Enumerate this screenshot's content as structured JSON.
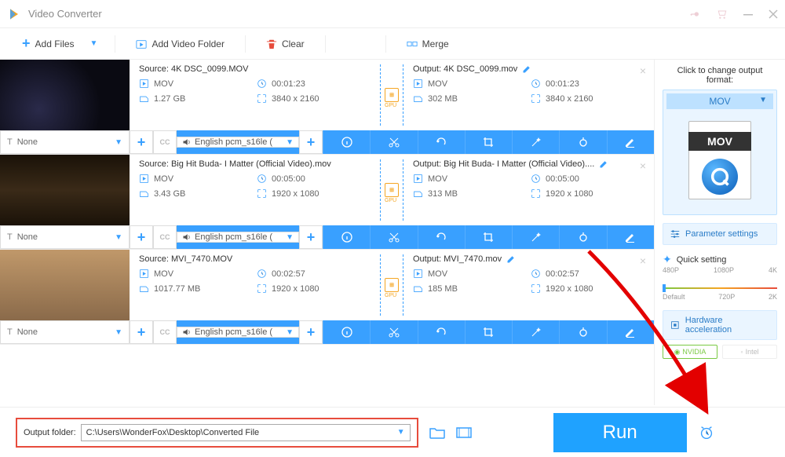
{
  "app": {
    "title": "Video Converter"
  },
  "toolbar": {
    "add_files": "Add Files",
    "add_folder": "Add Video Folder",
    "clear": "Clear",
    "merge": "Merge"
  },
  "items": [
    {
      "source_label": "Source: 4K DSC_0099.MOV",
      "output_label": "Output: 4K DSC_0099.mov",
      "src": {
        "format": "MOV",
        "duration": "00:01:23",
        "size": "1.27 GB",
        "dims": "3840 x 2160"
      },
      "out": {
        "format": "MOV",
        "duration": "00:01:23",
        "size": "302 MB",
        "dims": "3840 x 2160"
      },
      "subtitle": "None",
      "audio": "English pcm_s16le (",
      "gpu": "GPU"
    },
    {
      "source_label": "Source: Big Hit Buda- I Matter (Official Video).mov",
      "output_label": "Output: Big Hit Buda- I Matter (Official Video)....",
      "src": {
        "format": "MOV",
        "duration": "00:05:00",
        "size": "3.43 GB",
        "dims": "1920 x 1080"
      },
      "out": {
        "format": "MOV",
        "duration": "00:05:00",
        "size": "313 MB",
        "dims": "1920 x 1080"
      },
      "subtitle": "None",
      "audio": "English pcm_s16le (",
      "gpu": "GPU"
    },
    {
      "source_label": "Source: MVI_7470.MOV",
      "output_label": "Output: MVI_7470.mov",
      "src": {
        "format": "MOV",
        "duration": "00:02:57",
        "size": "1017.77 MB",
        "dims": "1920 x 1080"
      },
      "out": {
        "format": "MOV",
        "duration": "00:02:57",
        "size": "185 MB",
        "dims": "1920 x 1080"
      },
      "subtitle": "None",
      "audio": "English pcm_s16le (",
      "gpu": "GPU"
    }
  ],
  "sidebar": {
    "label": "Click to change output format:",
    "format": "MOV",
    "mov_band": "MOV",
    "param": "Parameter settings",
    "quick": "Quick setting",
    "scale_top": [
      "480P",
      "1080P",
      "4K"
    ],
    "scale_bottom": [
      "Default",
      "720P",
      "2K"
    ],
    "hw": "Hardware acceleration",
    "nvidia": "NVIDIA",
    "intel": "Intel"
  },
  "bottom": {
    "label": "Output folder:",
    "path": "C:\\Users\\WonderFox\\Desktop\\Converted File",
    "run": "Run"
  }
}
